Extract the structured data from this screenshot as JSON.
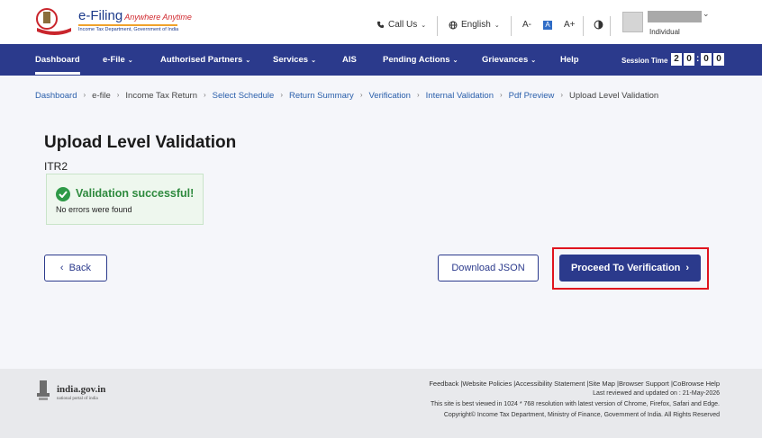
{
  "header": {
    "logo_title": "e-Filing",
    "logo_tagline": "Anywhere Anytime",
    "logo_subtitle": "Income Tax Department, Government of India",
    "call_us": "Call Us",
    "language": "English",
    "font_decrease": "A-",
    "font_normal": "A",
    "font_increase": "A+",
    "user_role": "Individual"
  },
  "nav": {
    "items": [
      {
        "label": "Dashboard"
      },
      {
        "label": "e-File"
      },
      {
        "label": "Authorised Partners"
      },
      {
        "label": "Services"
      },
      {
        "label": "AIS"
      },
      {
        "label": "Pending Actions"
      },
      {
        "label": "Grievances"
      },
      {
        "label": "Help"
      }
    ],
    "session_label": "Session Time",
    "session_digits": [
      "2",
      "0",
      "0",
      "0"
    ]
  },
  "breadcrumb": [
    "Dashboard",
    "e-file",
    "Income Tax Return",
    "Select Schedule",
    "Return Summary",
    "Verification",
    "Internal Validation",
    "Pdf Preview",
    "Upload Level Validation"
  ],
  "main": {
    "title": "Upload Level Validation",
    "form_name": "ITR2",
    "success_title": "Validation successful!",
    "success_desc": "No errors were found",
    "back_label": "Back",
    "download_label": "Download JSON",
    "proceed_label": "Proceed To Verification"
  },
  "footer": {
    "india_title": "india.gov.in",
    "india_sub": "national portal of india",
    "links": "Feedback |Website Policies |Accessibility Statement |Site Map |Browser Support |CoBrowse Help",
    "last_reviewed": "Last reviewed and updated on : 21-May-2026",
    "best_viewed": "This site is best viewed in 1024 * 768 resolution with latest version of Chrome, Firefox, Safari and Edge.",
    "copyright": "Copyright© Income Tax Department, Ministry of Finance, Government of India. All Rights Reserved"
  },
  "colors": {
    "nav_bg": "#2b3a8c",
    "success": "#2e9a47",
    "highlight": "#e0141e"
  }
}
